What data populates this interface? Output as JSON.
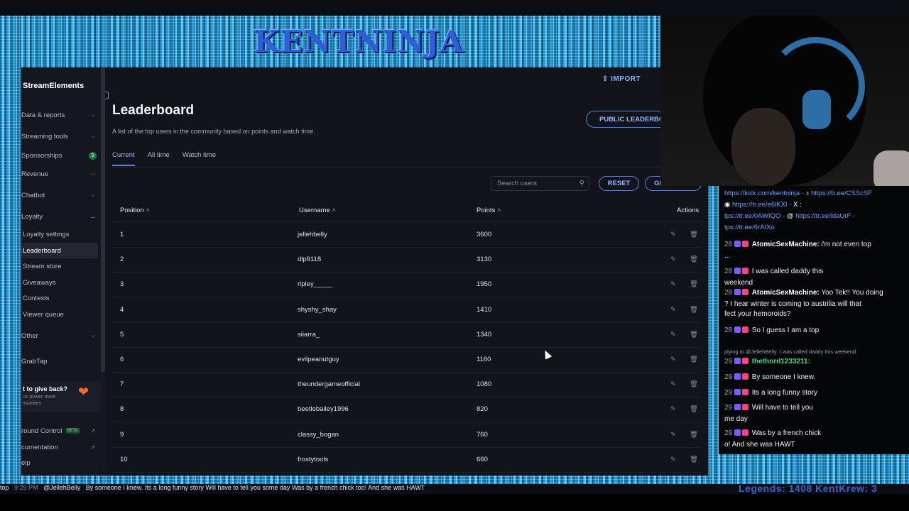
{
  "stream": {
    "title": "KENTNINJA",
    "legends": "Legends: 1408 KentKrew: 3"
  },
  "app": {
    "brand": "StreamElements",
    "top": {
      "import_label": "IMPORT"
    },
    "sidebar": {
      "items": [
        {
          "label": "Data & reports",
          "chevron": true
        },
        {
          "label": "Streaming tools",
          "chevron": true
        },
        {
          "label": "Sponsorships",
          "badge": "3"
        },
        {
          "label": "Revenue",
          "chevron": true
        },
        {
          "label": "Chatbot",
          "chevron": true
        },
        {
          "label": "Loyalty",
          "chevron": true
        }
      ],
      "loyalty_sub": [
        {
          "label": "Loyalty settings"
        },
        {
          "label": "Leaderboard"
        },
        {
          "label": "Stream store"
        },
        {
          "label": "Giveaways"
        },
        {
          "label": "Contests"
        },
        {
          "label": "Viewer queue"
        }
      ],
      "other": "Other",
      "grabtap": "GrabTap",
      "giveback_title": "t to give back?",
      "giveback_sub": "us power more munities",
      "ground_control": "round Control",
      "beta": "BETA",
      "documentation": "cumentation",
      "help": "elp"
    },
    "page": {
      "title": "Leaderboard",
      "subtitle": "A list of the top users in the community based on points and watch time.",
      "public_button": "PUBLIC LEADERBOA",
      "tabs": [
        "Current",
        "All time",
        "Watch time"
      ],
      "search_placeholder": "Search users",
      "reset_label": "RESET",
      "give_label": "GIVE PO",
      "columns": [
        "Position",
        "Username",
        "Points",
        "Actions"
      ],
      "rows": [
        {
          "pos": "1",
          "user": "jellehbelly",
          "points": "3600"
        },
        {
          "pos": "2",
          "user": "dlp9118",
          "points": "3130"
        },
        {
          "pos": "3",
          "user": "ripley_____",
          "points": "1950"
        },
        {
          "pos": "4",
          "user": "shyshy_shay",
          "points": "1410"
        },
        {
          "pos": "5",
          "user": "siiarra_",
          "points": "1340"
        },
        {
          "pos": "6",
          "user": "evilpeanutguy",
          "points": "1160"
        },
        {
          "pos": "7",
          "user": "theundergameofficial",
          "points": "1080"
        },
        {
          "pos": "8",
          "user": "beetlebailey1996",
          "points": "820"
        },
        {
          "pos": "9",
          "user": "classy_bogan",
          "points": "760"
        },
        {
          "pos": "10",
          "user": "frostytools",
          "points": "660"
        }
      ]
    }
  },
  "chat": {
    "links_line1": "https://kick.com/kentninja - ",
    "links_line1b": "https://tr.ee/CSScSF",
    "links_line2": "https://tr.ee/e6lKXI - ",
    "links_line2b": "X :",
    "links_line3": "tps://tr.ee/0AWIQO - ",
    "links_line3b": "https://tr.ee/ldaUrF -",
    "links_line4": "tps://tr.ee/6rAIXo",
    "messages": [
      {
        "time": "28",
        "user": "AtomicSexMachine:",
        "text": "i'm not even top",
        "extra": "..."
      },
      {
        "time": "28",
        "user": "",
        "text": "I was called daddy this",
        "extra": "weekend"
      },
      {
        "time": "28",
        "user": "AtomicSexMachine:",
        "text": "Yoo Tek!! You doing",
        "extra": "? I hear winter is coming to austrilia will that"
      },
      {
        "time": "",
        "user": "",
        "text": "fect your hemoroids?",
        "extra": ""
      },
      {
        "time": "28",
        "user": "",
        "text": "So I guess I am a top",
        "extra": ""
      },
      {
        "time": "",
        "user": "",
        "text": "plying to @JellehBelly: I was called daddy this weekend",
        "extra": ""
      },
      {
        "time": "29",
        "user": "thethord1233211:",
        "text": "",
        "extra": ""
      },
      {
        "time": "29",
        "user": "",
        "text": "By someone I knew.",
        "extra": ""
      },
      {
        "time": "29",
        "user": "",
        "text": "Its a long funny story",
        "extra": ""
      },
      {
        "time": "29",
        "user": "",
        "text": "Will have to tell you",
        "extra": "me day"
      },
      {
        "time": "29",
        "user": "",
        "text": "Was by a french chick",
        "extra": "o! And she was HAWT"
      }
    ]
  },
  "ticker": {
    "left": "top",
    "time": "9:29 PM",
    "mention": "@JellehBelly",
    "text": "By someone I knew.  Its a long funny story  Will have to tell you some day  Was by a french chick too! And she was HAWT"
  },
  "colors": {
    "accent": "#5d7dea",
    "frame": "#2aa6e0",
    "chat_link": "#5fa0ff"
  }
}
